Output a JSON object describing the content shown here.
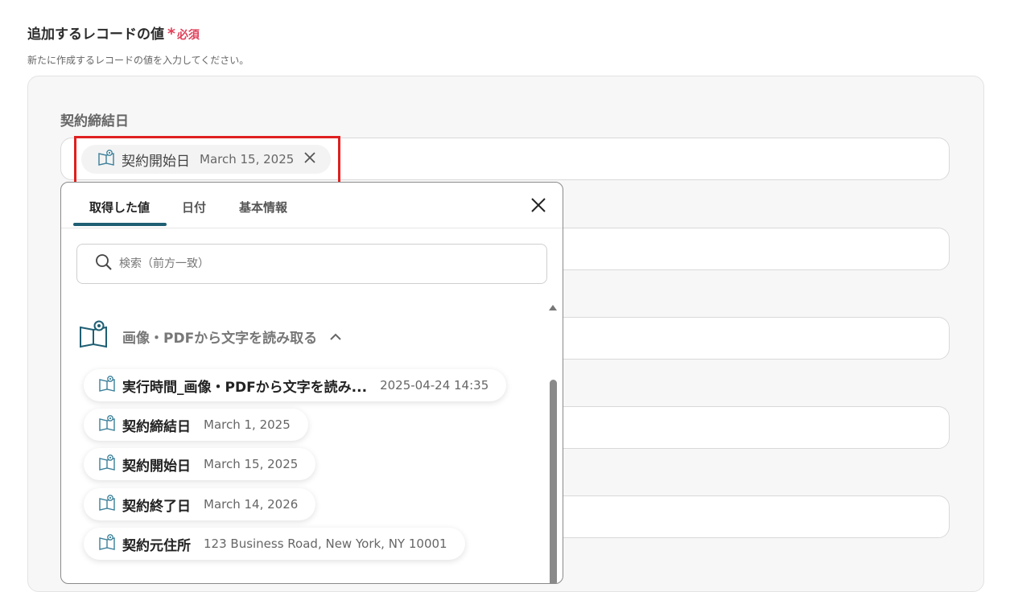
{
  "section": {
    "title": "追加するレコードの値",
    "required_star": "*",
    "required_text": "必須",
    "description": "新たに作成するレコードの値を入力してください。"
  },
  "field": {
    "label": "契約締結日",
    "token": {
      "label": "契約開始日",
      "value": "March 15, 2025",
      "icon": "book-eye-icon"
    }
  },
  "popup": {
    "tabs": [
      "取得した値",
      "日付",
      "基本情報"
    ],
    "active_tab": "取得した値",
    "search_placeholder": "検索（前方一致）",
    "group": {
      "title": "画像・PDFから文字を読み取る",
      "expanded": true
    },
    "items": [
      {
        "label": "実行時間_画像・PDFから文字を読み...",
        "value": "2025-04-24 14:35"
      },
      {
        "label": "契約締結日",
        "value": "March 1, 2025"
      },
      {
        "label": "契約開始日",
        "value": "March 15, 2025"
      },
      {
        "label": "契約終了日",
        "value": "March 14, 2026"
      },
      {
        "label": "契約元住所",
        "value": "123 Business Road, New York, NY 10001"
      }
    ]
  },
  "colors": {
    "required": "#e0405a",
    "highlight": "#e02020",
    "tab_accent": "#1f5f73",
    "icon": "#3a7f99"
  }
}
